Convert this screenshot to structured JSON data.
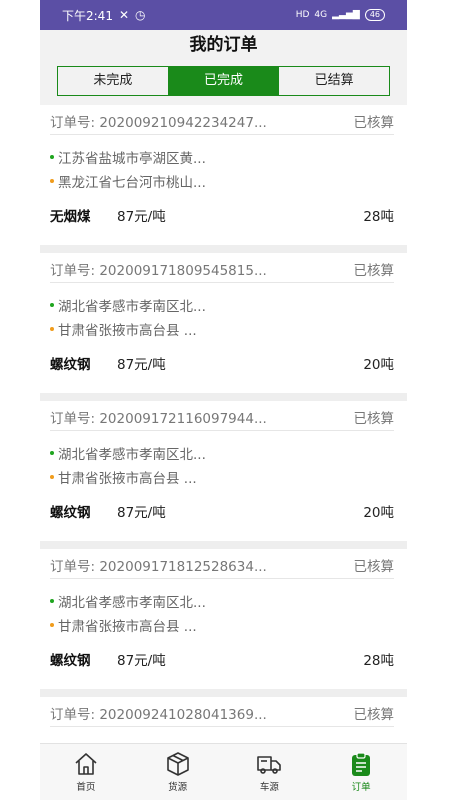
{
  "status": {
    "time": "下午2:41",
    "battery": "46",
    "signal": "4G"
  },
  "header": {
    "title": "我的订单"
  },
  "tabs": [
    {
      "label": "未完成",
      "active": false
    },
    {
      "label": "已完成",
      "active": true
    },
    {
      "label": "已结算",
      "active": false
    }
  ],
  "orders": [
    {
      "order_no": "订单号: 202009210942234247...",
      "status": "已核算",
      "from": "江苏省盐城市亭湖区黄...",
      "to": "黑龙江省七台河市桃山...",
      "goods": "无烟煤",
      "price": "87元/吨",
      "weight": "28吨"
    },
    {
      "order_no": "订单号: 202009171809545815...",
      "status": "已核算",
      "from": "湖北省孝感市孝南区北...",
      "to": "甘肃省张掖市高台县 ...",
      "goods": "螺纹钢",
      "price": "87元/吨",
      "weight": "20吨"
    },
    {
      "order_no": "订单号: 202009172116097944...",
      "status": "已核算",
      "from": "湖北省孝感市孝南区北...",
      "to": "甘肃省张掖市高台县 ...",
      "goods": "螺纹钢",
      "price": "87元/吨",
      "weight": "20吨"
    },
    {
      "order_no": "订单号: 202009171812528634...",
      "status": "已核算",
      "from": "湖北省孝感市孝南区北...",
      "to": "甘肃省张掖市高台县 ...",
      "goods": "螺纹钢",
      "price": "87元/吨",
      "weight": "28吨"
    },
    {
      "order_no": "订单号: 202009241028041369...",
      "status": "已核算"
    }
  ],
  "nav": [
    {
      "label": "首页",
      "icon": "home-icon"
    },
    {
      "label": "货源",
      "icon": "box-icon"
    },
    {
      "label": "车源",
      "icon": "truck-icon"
    },
    {
      "label": "订单",
      "icon": "clipboard-icon",
      "active": true
    }
  ],
  "colors": {
    "accent": "#1a8a1a",
    "statusbar": "#5b4fa5",
    "dot_from": "#1fa51f",
    "dot_to": "#f09c1c"
  }
}
